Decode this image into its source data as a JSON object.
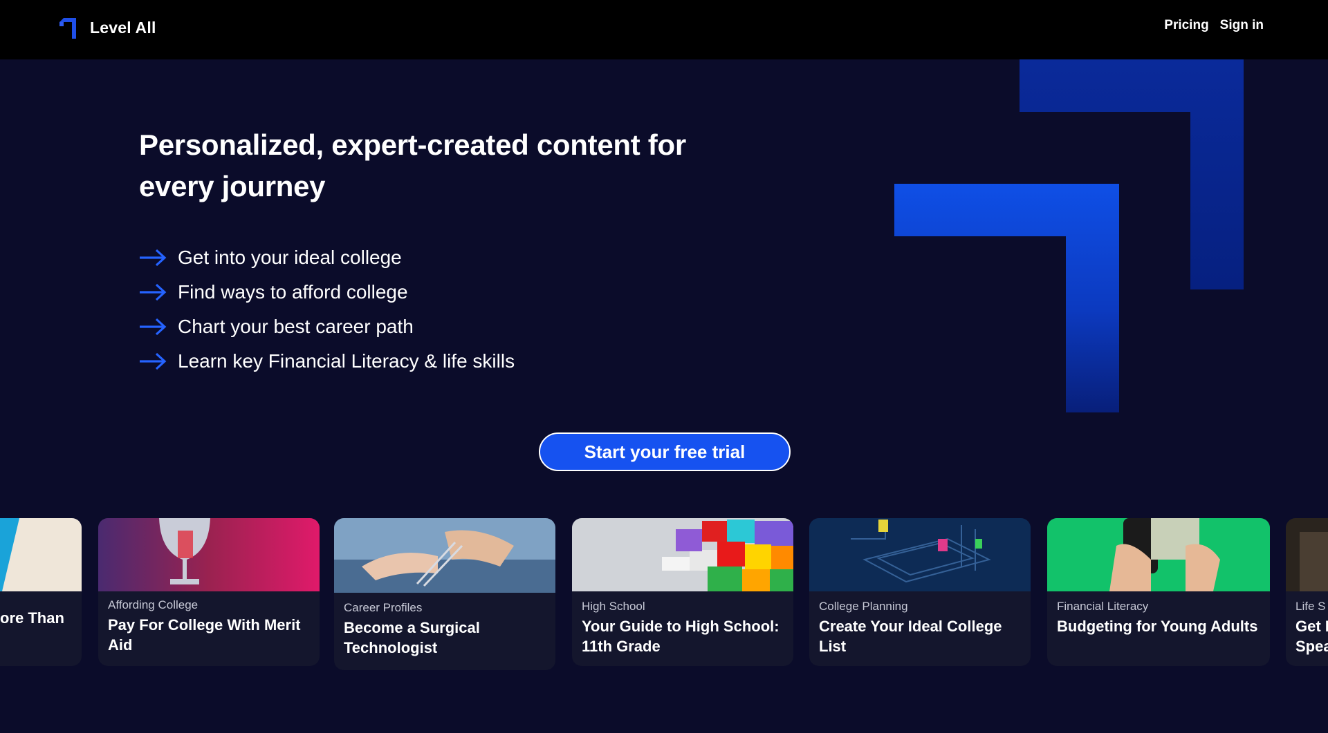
{
  "header": {
    "brand": "Level All",
    "nav": [
      "Pricing",
      "Sign in"
    ]
  },
  "hero": {
    "headline": "Personalized, expert-created content for every journey",
    "bullets": [
      "Get into your ideal college",
      "Find ways to afford college",
      "Chart your best career path",
      "Learn key Financial Literacy & life skills"
    ],
    "cta": "Start your free trial"
  },
  "cards": [
    {
      "category": "",
      "title": "ore Than"
    },
    {
      "category": "Affording College",
      "title": "Pay For College With Merit Aid"
    },
    {
      "category": "Career Profiles",
      "title": "Become a Surgical Technologist"
    },
    {
      "category": "High School",
      "title": "Your Guide to High School: 11th Grade"
    },
    {
      "category": "College Planning",
      "title": "Create Your Ideal College List"
    },
    {
      "category": "Financial Literacy",
      "title": "Budgeting for Young Adults"
    },
    {
      "category": "Life S",
      "title": "Get I Spea"
    }
  ],
  "colors": {
    "background": "#0b0c2a",
    "topbar": "#000000",
    "accent": "#1652f0",
    "card": "#14162d"
  }
}
